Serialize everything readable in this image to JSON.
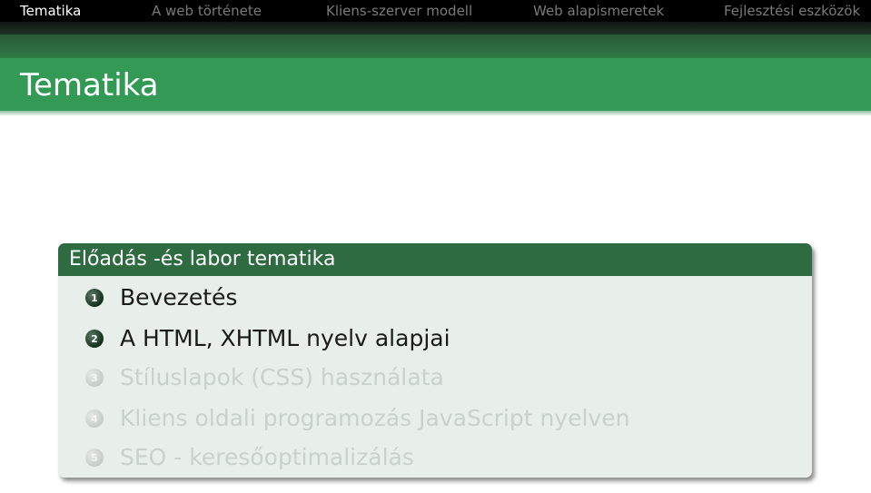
{
  "nav": {
    "items": [
      {
        "label": "Tematika",
        "active": true
      },
      {
        "label": "A web története",
        "active": false
      },
      {
        "label": "Kliens-szerver modell",
        "active": false
      },
      {
        "label": "Web alapismeretek",
        "active": false
      },
      {
        "label": "Fejlesztési eszközök",
        "active": false
      }
    ]
  },
  "frame": {
    "title": "Tematika"
  },
  "block": {
    "title": "Előadás -és labor tematika",
    "items": [
      {
        "number": "1",
        "label": "Bevezetés",
        "dimmed": false
      },
      {
        "number": "2",
        "label": "A HTML, XHTML nyelv alapjai",
        "dimmed": false
      },
      {
        "number": "3",
        "label": "Stíluslapok (CSS) használata",
        "dimmed": true
      },
      {
        "number": "4",
        "label": "Kliens oldali programozás JavaScript nyelven",
        "dimmed": true
      },
      {
        "number": "5",
        "label": "SEO - keresőoptimalizálás",
        "dimmed": true
      }
    ]
  },
  "colors": {
    "nav_bg": "#000000",
    "title_bar": "#339a55",
    "block_header": "#2e6b41",
    "block_body": "#e8efea"
  }
}
